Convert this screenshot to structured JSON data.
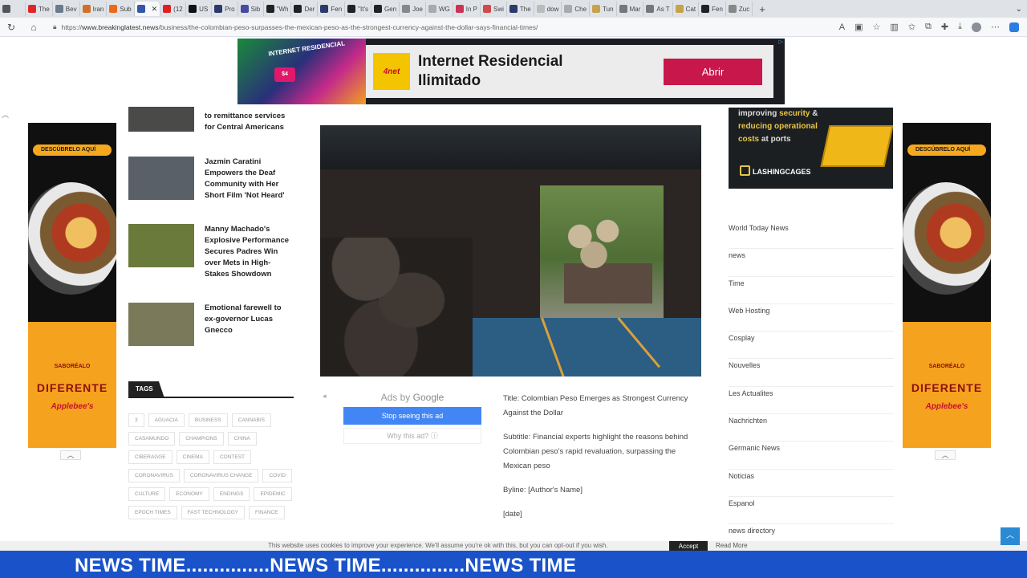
{
  "browser": {
    "tabs": [
      {
        "label": "",
        "color": "#555555"
      },
      {
        "label": "The",
        "color": "#e0252a"
      },
      {
        "label": "Bev",
        "color": "#6a7a8c"
      },
      {
        "label": "Iran",
        "color": "#d0702a"
      },
      {
        "label": "Sub",
        "color": "#e86a1a"
      },
      {
        "label": "",
        "color": "#3355aa",
        "active": true
      },
      {
        "label": "(12",
        "color": "#e02020"
      },
      {
        "label": "US",
        "color": "#111111"
      },
      {
        "label": "Pro",
        "color": "#2a3a6a"
      },
      {
        "label": "Sib",
        "color": "#4a4aa0"
      },
      {
        "label": "\"Wh",
        "color": "#222222"
      },
      {
        "label": "Der",
        "color": "#222222"
      },
      {
        "label": "Fen",
        "color": "#2a3a6a"
      },
      {
        "label": "\"It's",
        "color": "#222222"
      },
      {
        "label": "Gen",
        "color": "#222222"
      },
      {
        "label": "Joe",
        "color": "#888888"
      },
      {
        "label": "WG",
        "color": "#aaaaaa"
      },
      {
        "label": "In P",
        "color": "#cc3355"
      },
      {
        "label": "Swi",
        "color": "#d04a4a"
      },
      {
        "label": "The",
        "color": "#2a3a6a"
      },
      {
        "label": "dow",
        "color": "#bbbbbb"
      },
      {
        "label": "Che",
        "color": "#aaaaaa"
      },
      {
        "label": "Tun",
        "color": "#c8a24a"
      },
      {
        "label": "Mar",
        "color": "#777777"
      },
      {
        "label": "As T",
        "color": "#777777"
      },
      {
        "label": "Cat",
        "color": "#c8a24a"
      },
      {
        "label": "Fen",
        "color": "#222222"
      },
      {
        "label": "Zuc",
        "color": "#888888"
      }
    ],
    "url_prefix": "https://",
    "url_host": "www.breakinglatest.news",
    "url_path": "/business/the-colombian-peso-surpasses-the-mexican-peso-as-the-strongest-currency-against-the-dollar-says-financial-times/",
    "new_tab_symbol": "+"
  },
  "top_ad": {
    "promo_title": "INTERNET RESIDENCIAL",
    "promo_price": "$4",
    "logo": "4net",
    "headline_line1": "Internet Residencial",
    "headline_line2": "Ilimitado",
    "cta": "Abrir",
    "adchoice": "▷"
  },
  "side_ads": {
    "tag": "DESCÚBRELO AQUÍ",
    "tagline_small": "SABORÉALO",
    "tagline_big": "DIFERENTE",
    "brand": "Applebee's"
  },
  "left_news": [
    {
      "title": "to remittance services for Central Americans",
      "thumb": "#4a4a48"
    },
    {
      "title": "Jazmin Caratini Empowers the Deaf Community with Her Short Film 'Not Heard'",
      "thumb": "#5a6068"
    },
    {
      "title": "Manny Machado's Explosive Performance Secures Padres Win over Mets in High-Stakes Showdown",
      "thumb": "#6a7a3a"
    },
    {
      "title": "Emotional farewell to ex-governor Lucas Gnecco",
      "thumb": "#7a7a5a"
    }
  ],
  "tags": {
    "heading": "TAGS",
    "items": [
      "3",
      "AGUACIA",
      "BUSINESS",
      "CANNABIS",
      "CASAMUNDO",
      "CHAMPIONS",
      "CHINA",
      "CIBERAGGE",
      "CINEMA",
      "CONTEST",
      "CORONAVIRUS",
      "CORONAVIRUS CHANGE",
      "COVID",
      "CULTURE",
      "ECONOMY",
      "ENDINGS",
      "EPIDEMIC",
      "EPOCH TIMES",
      "FAST TECHNOLOGY",
      "FINANCE"
    ]
  },
  "ads_by_google": {
    "label": "Ads by",
    "brand": "Google",
    "stop": "Stop seeing this ad",
    "why": "Why this ad? ⓘ",
    "close": "◂"
  },
  "article": {
    "title": "Title: Colombian Peso Emerges as Strongest Currency Against the Dollar",
    "subtitle": "Subtitle: Financial experts highlight the reasons behind Colombian peso's rapid revaluation, surpassing the Mexican peso",
    "byline": "Byline: [Author's Name]",
    "date": "[date]"
  },
  "right_ad": {
    "line1_white": "improving",
    "line1_accent": "security",
    "line1_end": "&",
    "line2": "reducing operational",
    "line3_accent": "costs",
    "line3_end": "at ports",
    "brand": "LASHINGCAGES"
  },
  "categories": [
    "World Today News",
    "news",
    "Time",
    "Web Hosting",
    "Cosplay",
    "Nouvelles",
    "Les Actualites",
    "Nachrichten",
    "Germanic News",
    "Noticias",
    "Espanol",
    "news directory"
  ],
  "cookie": {
    "message": "This website uses cookies to improve your experience. We'll assume you're ok with this, but you can opt-out if you wish.",
    "accept": "Accept",
    "read_more": "Read More"
  },
  "ticker": {
    "text": "NEWS TIME...............NEWS TIME...............NEWS TIME"
  },
  "colors": {
    "ticker_bg": "#1a53c9",
    "cta_bg": "#c8174a",
    "ad_accent": "#f5a21e",
    "scrolltop": "#2a8ad4"
  }
}
